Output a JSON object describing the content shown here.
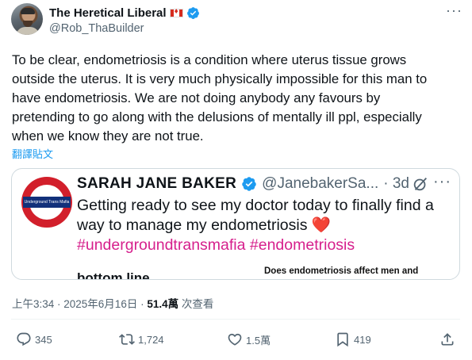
{
  "author": {
    "display_name": "The Heretical Liberal",
    "handle": "@Rob_ThaBuilder"
  },
  "tweet": {
    "text": "To be clear, endometriosis is a condition where uterus tissue grows\noutside the uterus. It is very much physically impossible for this man to\nhave endometriosis. We are not doing anybody any favours by\npretending to go along with the delusions of mentally ill ppl, especially\nwhen we know they are not true.",
    "translate_label": "翻譯貼文"
  },
  "quoted": {
    "avatar_text": "Underground Trans Mafia",
    "name": "SARAH JANE BAKER",
    "handle": "@JanebakerSa...",
    "time": "· 3d",
    "text": "Getting ready to see my doctor today to finally find a way to manage my endometriosis",
    "heart": "❤️",
    "tags": "#undergroundtransmafia #endometriosis",
    "partial_left": "bottom line",
    "partial_right": "Does endometriosis affect men and"
  },
  "meta": {
    "timestamp": "上午3:34 · 2025年6月16日 · ",
    "views_count": "51.4萬",
    "views_label": " 次查看"
  },
  "actions": {
    "replies": "345",
    "reposts": "1,724",
    "likes": "1.5萬",
    "bookmarks": "419"
  },
  "colors": {
    "link": "#1d9bf0",
    "hashtag": "#d61f8c",
    "muted": "#536471",
    "verified": "#1d9bf0"
  }
}
